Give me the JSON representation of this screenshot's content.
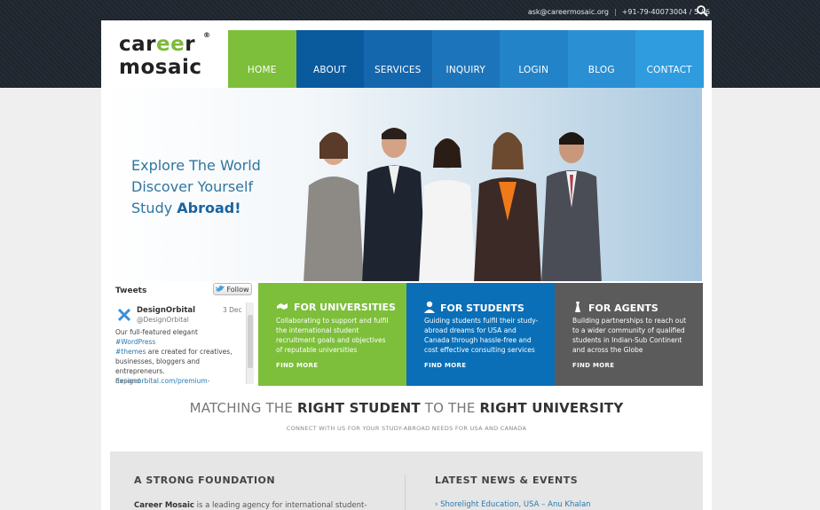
{
  "topbar": {
    "email": "ask@careermosaic.org",
    "phone": "+91-79-40073004 / 5 / 6"
  },
  "logo": {
    "line1_a": "car",
    "line1_b": "ee",
    "line1_c": "r",
    "line2": "mosaic",
    "reg": "®"
  },
  "nav": {
    "items": [
      {
        "label": "HOME",
        "color": "#7dbf3a"
      },
      {
        "label": "ABOUT",
        "color": "#0a5a9e"
      },
      {
        "label": "SERVICES",
        "color": "#1467ad"
      },
      {
        "label": "INQUIRY",
        "color": "#1c75ba"
      },
      {
        "label": "LOGIN",
        "color": "#2383c8"
      },
      {
        "label": "BLOG",
        "color": "#2b8fd3"
      },
      {
        "label": "CONTACT",
        "color": "#2f9cdf"
      }
    ]
  },
  "hero": {
    "line1": "Explore The World",
    "line2": "Discover Yourself",
    "line3_a": "Study ",
    "line3_b": "Abroad!"
  },
  "tweets": {
    "heading": "Tweets",
    "follow": "Follow",
    "name": "DesignOrbital",
    "handle": "@DesignOrbital",
    "date": "3 Dec",
    "body_a": "Our full-featured elegant ",
    "tag1": "#WordPress",
    "tag2": "#themes",
    "body_b": " are created for creatives, businesses, bloggers and entrepreneurs.",
    "link": "designorbital.com/premium-wordpr…",
    "expand": "Expand"
  },
  "boxes": [
    {
      "title": "FOR UNIVERSITIES",
      "icon": "handshake-icon",
      "color": "#7dbf3a",
      "desc": "Collaborating to support and fulfil the international student recruitment goals and objectives of reputable universities",
      "more": "FIND MORE"
    },
    {
      "title": "FOR STUDENTS",
      "icon": "student-icon",
      "color": "#0a6fb7",
      "desc": "Guiding students fulfil their study-abroad dreams for USA and Canada through hassle-free and cost effective consulting services",
      "more": "FIND MORE"
    },
    {
      "title": "FOR AGENTS",
      "icon": "agent-icon",
      "color": "#5b5b5b",
      "desc": "Building partnerships to reach out to a wider community of qualified students in Indian-Sub Continent and across the Globe",
      "more": "FIND MORE"
    }
  ],
  "tagline": {
    "a": "MATCHING THE ",
    "b": "RIGHT STUDENT",
    "c": " TO THE ",
    "d": "RIGHT UNIVERSITY"
  },
  "subtag": "CONNECT WITH US FOR YOUR STUDY-ABROAD NEEDS FOR USA AND CANADA",
  "foundation": {
    "heading": "A STRONG FOUNDATION",
    "text_b": "Career Mosaic",
    "text": " is a leading agency for international student-"
  },
  "news": {
    "heading": "LATEST NEWS & EVENTS",
    "item": "Shorelight Education, USA – Anu Khalan"
  }
}
